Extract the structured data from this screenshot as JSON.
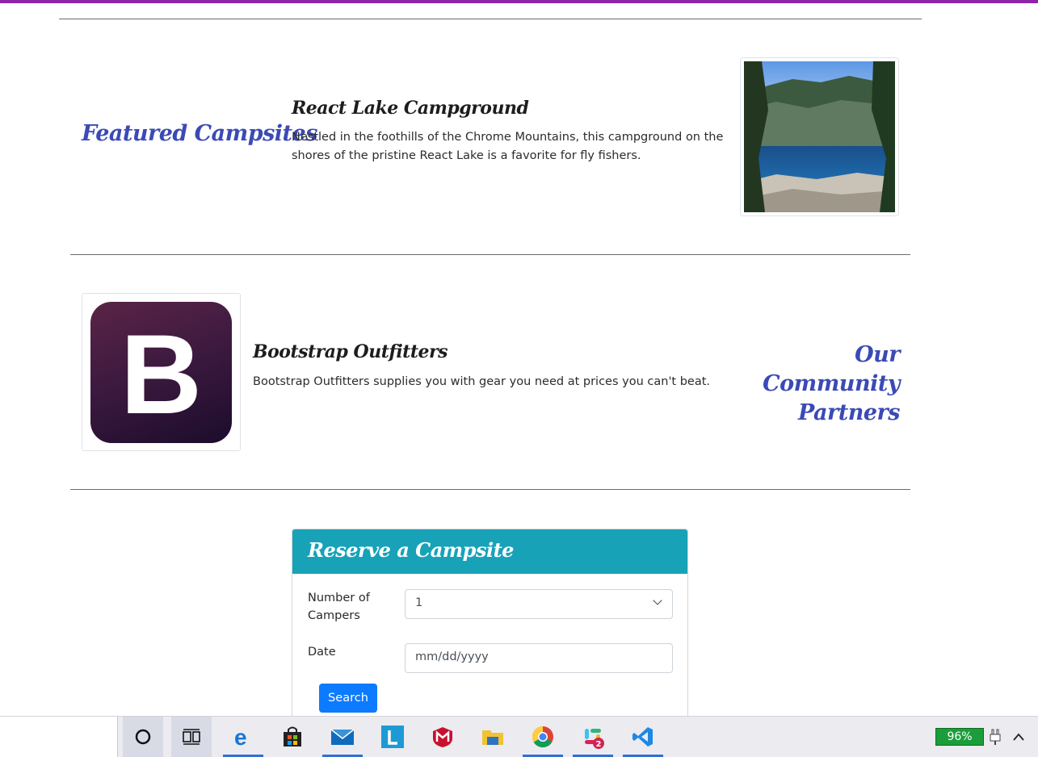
{
  "featured": {
    "heading": "Featured Campsites",
    "title": "React Lake Campground",
    "text": "Nestled in the foothills of the Chrome Mountains, this campground on the shores of the pristine React Lake is a favorite for fly fishers."
  },
  "partners": {
    "heading": "Our Community Partners",
    "logo_letter": "B",
    "title": "Bootstrap Outfitters",
    "text": "Bootstrap Outfitters supplies you with gear you need at prices you can't beat."
  },
  "reserve": {
    "heading": "Reserve a Campsite",
    "campers_label": "Number of Campers",
    "campers_value": "1",
    "date_label": "Date",
    "date_placeholder": "mm/dd/yyyy",
    "search_label": "Search"
  },
  "taskbar": {
    "battery": "96%",
    "slack_badge": "2",
    "apps": [
      "cortana-icon",
      "task-view-icon",
      "edge-icon",
      "store-icon",
      "mail-icon",
      "l-app-icon",
      "mcafee-icon",
      "file-explorer-icon",
      "chrome-icon",
      "slack-icon",
      "vscode-icon"
    ]
  },
  "colors": {
    "accent": "#8e24aa",
    "heading_blue": "#3b4ab5",
    "card_header": "#17a2b8",
    "button": "#0d7bff"
  }
}
